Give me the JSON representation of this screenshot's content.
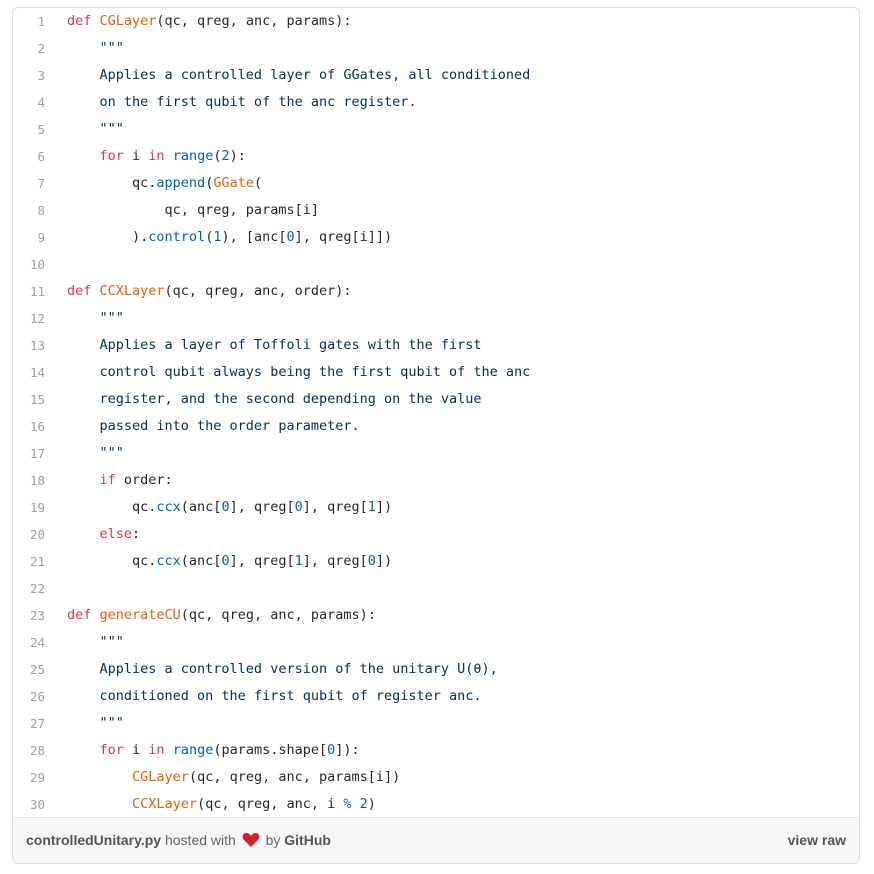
{
  "lines": [
    {
      "n": "1",
      "t": [
        {
          "c": "kw",
          "s": "def "
        },
        {
          "c": "fn",
          "s": "CGLayer"
        },
        {
          "c": "",
          "s": "(qc, qreg, anc, params):"
        }
      ]
    },
    {
      "n": "2",
      "t": [
        {
          "c": "st",
          "s": "    \"\"\""
        }
      ]
    },
    {
      "n": "3",
      "t": [
        {
          "c": "st",
          "s": "    Applies a controlled layer of GGates, all conditioned"
        }
      ]
    },
    {
      "n": "4",
      "t": [
        {
          "c": "st",
          "s": "    on the first qubit of the anc register."
        }
      ]
    },
    {
      "n": "5",
      "t": [
        {
          "c": "st",
          "s": "    \"\"\""
        }
      ]
    },
    {
      "n": "6",
      "t": [
        {
          "c": "",
          "s": "    "
        },
        {
          "c": "kw",
          "s": "for"
        },
        {
          "c": "",
          "s": " i "
        },
        {
          "c": "kw",
          "s": "in"
        },
        {
          "c": "",
          "s": " "
        },
        {
          "c": "bl",
          "s": "range"
        },
        {
          "c": "",
          "s": "("
        },
        {
          "c": "bl",
          "s": "2"
        },
        {
          "c": "",
          "s": "):"
        }
      ]
    },
    {
      "n": "7",
      "t": [
        {
          "c": "",
          "s": "        qc."
        },
        {
          "c": "bl",
          "s": "append"
        },
        {
          "c": "",
          "s": "("
        },
        {
          "c": "fn",
          "s": "GGate"
        },
        {
          "c": "",
          "s": "("
        }
      ]
    },
    {
      "n": "8",
      "t": [
        {
          "c": "",
          "s": "            qc, qreg, params[i]"
        }
      ]
    },
    {
      "n": "9",
      "t": [
        {
          "c": "",
          "s": "        )."
        },
        {
          "c": "bl",
          "s": "control"
        },
        {
          "c": "",
          "s": "("
        },
        {
          "c": "bl",
          "s": "1"
        },
        {
          "c": "",
          "s": "), [anc["
        },
        {
          "c": "bl",
          "s": "0"
        },
        {
          "c": "",
          "s": "], qreg[i]])"
        }
      ]
    },
    {
      "n": "10",
      "t": [
        {
          "c": "",
          "s": ""
        }
      ]
    },
    {
      "n": "11",
      "t": [
        {
          "c": "kw",
          "s": "def "
        },
        {
          "c": "fn",
          "s": "CCXLayer"
        },
        {
          "c": "",
          "s": "(qc, qreg, anc, order):"
        }
      ]
    },
    {
      "n": "12",
      "t": [
        {
          "c": "st",
          "s": "    \"\"\""
        }
      ]
    },
    {
      "n": "13",
      "t": [
        {
          "c": "st",
          "s": "    Applies a layer of Toffoli gates with the first"
        }
      ]
    },
    {
      "n": "14",
      "t": [
        {
          "c": "st",
          "s": "    control qubit always being the first qubit of the anc"
        }
      ]
    },
    {
      "n": "15",
      "t": [
        {
          "c": "st",
          "s": "    register, and the second depending on the value"
        }
      ]
    },
    {
      "n": "16",
      "t": [
        {
          "c": "st",
          "s": "    passed into the order parameter."
        }
      ]
    },
    {
      "n": "17",
      "t": [
        {
          "c": "st",
          "s": "    \"\"\""
        }
      ]
    },
    {
      "n": "18",
      "t": [
        {
          "c": "",
          "s": "    "
        },
        {
          "c": "kw",
          "s": "if"
        },
        {
          "c": "",
          "s": " order:"
        }
      ]
    },
    {
      "n": "19",
      "t": [
        {
          "c": "",
          "s": "        qc."
        },
        {
          "c": "bl",
          "s": "ccx"
        },
        {
          "c": "",
          "s": "(anc["
        },
        {
          "c": "bl",
          "s": "0"
        },
        {
          "c": "",
          "s": "], qreg["
        },
        {
          "c": "bl",
          "s": "0"
        },
        {
          "c": "",
          "s": "], qreg["
        },
        {
          "c": "bl",
          "s": "1"
        },
        {
          "c": "",
          "s": "])"
        }
      ]
    },
    {
      "n": "20",
      "t": [
        {
          "c": "",
          "s": "    "
        },
        {
          "c": "kw",
          "s": "else"
        },
        {
          "c": "",
          "s": ":"
        }
      ]
    },
    {
      "n": "21",
      "t": [
        {
          "c": "",
          "s": "        qc."
        },
        {
          "c": "bl",
          "s": "ccx"
        },
        {
          "c": "",
          "s": "(anc["
        },
        {
          "c": "bl",
          "s": "0"
        },
        {
          "c": "",
          "s": "], qreg["
        },
        {
          "c": "bl",
          "s": "1"
        },
        {
          "c": "",
          "s": "], qreg["
        },
        {
          "c": "bl",
          "s": "0"
        },
        {
          "c": "",
          "s": "])"
        }
      ]
    },
    {
      "n": "22",
      "t": [
        {
          "c": "",
          "s": ""
        }
      ]
    },
    {
      "n": "23",
      "t": [
        {
          "c": "kw",
          "s": "def "
        },
        {
          "c": "fn",
          "s": "generateCU"
        },
        {
          "c": "",
          "s": "(qc, qreg, anc, params):"
        }
      ]
    },
    {
      "n": "24",
      "t": [
        {
          "c": "st",
          "s": "    \"\"\""
        }
      ]
    },
    {
      "n": "25",
      "t": [
        {
          "c": "st",
          "s": "    Applies a controlled version of the unitary U(θ),"
        }
      ]
    },
    {
      "n": "26",
      "t": [
        {
          "c": "st",
          "s": "    conditioned on the first qubit of register anc."
        }
      ]
    },
    {
      "n": "27",
      "t": [
        {
          "c": "st",
          "s": "    \"\"\""
        }
      ]
    },
    {
      "n": "28",
      "t": [
        {
          "c": "",
          "s": "    "
        },
        {
          "c": "kw",
          "s": "for"
        },
        {
          "c": "",
          "s": " i "
        },
        {
          "c": "kw",
          "s": "in"
        },
        {
          "c": "",
          "s": " "
        },
        {
          "c": "bl",
          "s": "range"
        },
        {
          "c": "",
          "s": "(params.shape["
        },
        {
          "c": "bl",
          "s": "0"
        },
        {
          "c": "",
          "s": "]):"
        }
      ]
    },
    {
      "n": "29",
      "t": [
        {
          "c": "",
          "s": "        "
        },
        {
          "c": "fn",
          "s": "CGLayer"
        },
        {
          "c": "",
          "s": "(qc, qreg, anc, params[i])"
        }
      ]
    },
    {
      "n": "30",
      "t": [
        {
          "c": "",
          "s": "        "
        },
        {
          "c": "fn",
          "s": "CCXLayer"
        },
        {
          "c": "",
          "s": "(qc, qreg, anc, i "
        },
        {
          "c": "bl",
          "s": "%"
        },
        {
          "c": "",
          "s": " "
        },
        {
          "c": "bl",
          "s": "2"
        },
        {
          "c": "",
          "s": ")"
        }
      ]
    }
  ],
  "footer": {
    "filename": "controlledUnitary.py",
    "hosted_with": "hosted with",
    "by": "by",
    "github": "GitHub",
    "view_raw": "view raw",
    "heart_icon": "heart-icon",
    "heart_color": "#cb2431"
  }
}
